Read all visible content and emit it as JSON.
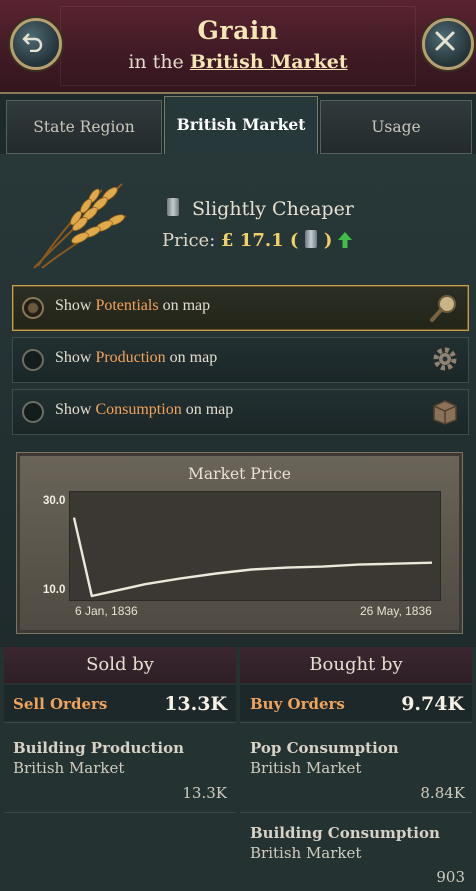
{
  "header": {
    "title": "Grain",
    "subtitle_prefix": "in the",
    "subtitle_link": "British Market"
  },
  "tabs": [
    {
      "label": "State Region",
      "active": false
    },
    {
      "label": "British Market",
      "active": true
    },
    {
      "label": "Usage",
      "active": false
    }
  ],
  "goods": {
    "icon": "wheat-icon",
    "status": "Slightly Cheaper",
    "price_label": "Price:",
    "price_value": "£ 17.1 (",
    "price_close": ")",
    "trend": "up"
  },
  "map_options": [
    {
      "prefix": "Show ",
      "highlight": "Potentials",
      "suffix": " on map",
      "icon": "magnifier-icon",
      "selected": true
    },
    {
      "prefix": "Show ",
      "highlight": "Production",
      "suffix": " on map",
      "icon": "gear-icon",
      "selected": false
    },
    {
      "prefix": "Show ",
      "highlight": "Consumption",
      "suffix": " on map",
      "icon": "crate-icon",
      "selected": false
    }
  ],
  "chart_data": {
    "type": "line",
    "title": "Market Price",
    "x_start_label": "6 Jan, 1836",
    "x_end_label": "26 May, 1836",
    "y_max_label": "30.0",
    "y_min_label": "10.0",
    "ylim": [
      10.0,
      30.0
    ],
    "x": [
      "1836-01-06",
      "1836-01-13",
      "1836-01-20",
      "1836-02-03",
      "1836-02-17",
      "1836-03-02",
      "1836-03-16",
      "1836-03-30",
      "1836-04-13",
      "1836-04-27",
      "1836-05-11",
      "1836-05-26"
    ],
    "series": [
      {
        "values": [
          26.0,
          10.0,
          10.8,
          12.4,
          13.6,
          14.6,
          15.4,
          15.8,
          16.0,
          16.4,
          16.6,
          16.8
        ]
      }
    ]
  },
  "sold_by": {
    "header": "Sold by",
    "orders_label": "Sell Orders",
    "orders_value": "13.3K",
    "entries": [
      {
        "title": "Building Production",
        "market": "British Market",
        "value": "13.3K"
      }
    ]
  },
  "bought_by": {
    "header": "Bought by",
    "orders_label": "Buy Orders",
    "orders_value": "9.74K",
    "entries": [
      {
        "title": "Pop Consumption",
        "market": "British Market",
        "value": "8.84K"
      },
      {
        "title": "Building Consumption",
        "market": "British Market",
        "value": "903"
      }
    ]
  },
  "colors": {
    "accent_orange": "#f0a35c",
    "price_gold": "#f0cf6a",
    "header_bg": "#4a1f2a",
    "trend_up": "#3fbf4a"
  }
}
